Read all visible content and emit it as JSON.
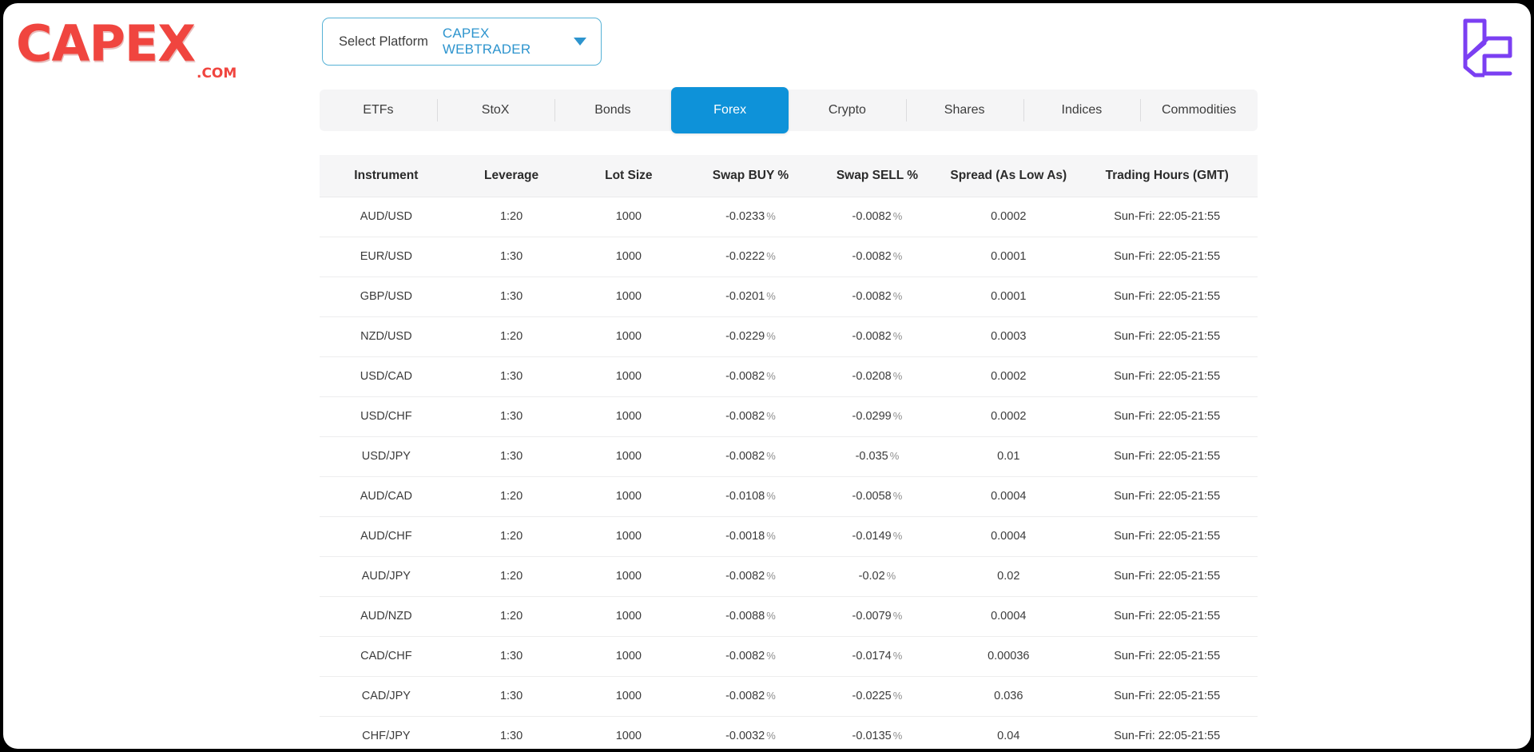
{
  "brand": {
    "logo_word": "CAPEX",
    "logo_suffix": ".COM",
    "mark_icon": "lc-monogram-icon",
    "mark_color": "#7b3ff2"
  },
  "platform_selector": {
    "label": "Select Platform",
    "value": "CAPEX WEBTRADER",
    "caret_icon": "chevron-down-icon",
    "accent_color": "#2d94ce"
  },
  "tabs": [
    {
      "label": "ETFs",
      "active": false
    },
    {
      "label": "StoX",
      "active": false
    },
    {
      "label": "Bonds",
      "active": false
    },
    {
      "label": "Forex",
      "active": true
    },
    {
      "label": "Crypto",
      "active": false
    },
    {
      "label": "Shares",
      "active": false
    },
    {
      "label": "Indices",
      "active": false
    },
    {
      "label": "Commodities",
      "active": false
    }
  ],
  "table": {
    "columns": [
      "Instrument",
      "Leverage",
      "Lot Size",
      "Swap BUY %",
      "Swap SELL %",
      "Spread (As Low As)",
      "Trading Hours (GMT)"
    ],
    "percent_symbol": "%",
    "rows": [
      {
        "instrument": "AUD/USD",
        "leverage": "1:20",
        "lot_size": "1000",
        "swap_buy": "-0.0233",
        "swap_sell": "-0.0082",
        "spread": "0.0002",
        "hours": "Sun-Fri: 22:05-21:55"
      },
      {
        "instrument": "EUR/USD",
        "leverage": "1:30",
        "lot_size": "1000",
        "swap_buy": "-0.0222",
        "swap_sell": "-0.0082",
        "spread": "0.0001",
        "hours": "Sun-Fri: 22:05-21:55"
      },
      {
        "instrument": "GBP/USD",
        "leverage": "1:30",
        "lot_size": "1000",
        "swap_buy": "-0.0201",
        "swap_sell": "-0.0082",
        "spread": "0.0001",
        "hours": "Sun-Fri: 22:05-21:55"
      },
      {
        "instrument": "NZD/USD",
        "leverage": "1:20",
        "lot_size": "1000",
        "swap_buy": "-0.0229",
        "swap_sell": "-0.0082",
        "spread": "0.0003",
        "hours": "Sun-Fri: 22:05-21:55"
      },
      {
        "instrument": "USD/CAD",
        "leverage": "1:30",
        "lot_size": "1000",
        "swap_buy": "-0.0082",
        "swap_sell": "-0.0208",
        "spread": "0.0002",
        "hours": "Sun-Fri: 22:05-21:55"
      },
      {
        "instrument": "USD/CHF",
        "leverage": "1:30",
        "lot_size": "1000",
        "swap_buy": "-0.0082",
        "swap_sell": "-0.0299",
        "spread": "0.0002",
        "hours": "Sun-Fri: 22:05-21:55"
      },
      {
        "instrument": "USD/JPY",
        "leverage": "1:30",
        "lot_size": "1000",
        "swap_buy": "-0.0082",
        "swap_sell": "-0.035",
        "spread": "0.01",
        "hours": "Sun-Fri: 22:05-21:55"
      },
      {
        "instrument": "AUD/CAD",
        "leverage": "1:20",
        "lot_size": "1000",
        "swap_buy": "-0.0108",
        "swap_sell": "-0.0058",
        "spread": "0.0004",
        "hours": "Sun-Fri: 22:05-21:55"
      },
      {
        "instrument": "AUD/CHF",
        "leverage": "1:20",
        "lot_size": "1000",
        "swap_buy": "-0.0018",
        "swap_sell": "-0.0149",
        "spread": "0.0004",
        "hours": "Sun-Fri: 22:05-21:55"
      },
      {
        "instrument": "AUD/JPY",
        "leverage": "1:20",
        "lot_size": "1000",
        "swap_buy": "-0.0082",
        "swap_sell": "-0.02",
        "spread": "0.02",
        "hours": "Sun-Fri: 22:05-21:55"
      },
      {
        "instrument": "AUD/NZD",
        "leverage": "1:20",
        "lot_size": "1000",
        "swap_buy": "-0.0088",
        "swap_sell": "-0.0079",
        "spread": "0.0004",
        "hours": "Sun-Fri: 22:05-21:55"
      },
      {
        "instrument": "CAD/CHF",
        "leverage": "1:30",
        "lot_size": "1000",
        "swap_buy": "-0.0082",
        "swap_sell": "-0.0174",
        "spread": "0.00036",
        "hours": "Sun-Fri: 22:05-21:55"
      },
      {
        "instrument": "CAD/JPY",
        "leverage": "1:30",
        "lot_size": "1000",
        "swap_buy": "-0.0082",
        "swap_sell": "-0.0225",
        "spread": "0.036",
        "hours": "Sun-Fri: 22:05-21:55"
      },
      {
        "instrument": "CHF/JPY",
        "leverage": "1:30",
        "lot_size": "1000",
        "swap_buy": "-0.0032",
        "swap_sell": "-0.0135",
        "spread": "0.04",
        "hours": "Sun-Fri: 22:05-21:55"
      }
    ]
  }
}
